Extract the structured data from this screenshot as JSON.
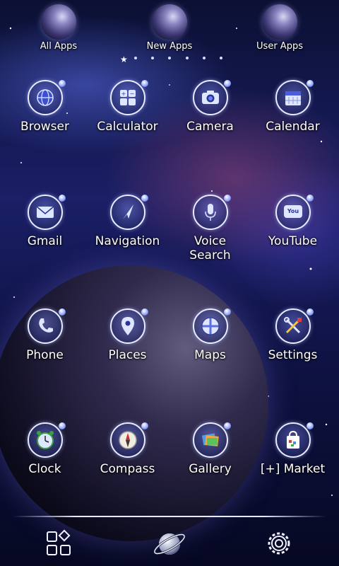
{
  "top_bar": {
    "items": [
      {
        "label": "All Apps",
        "icon": "planet-icon"
      },
      {
        "label": "New Apps",
        "icon": "planet-icon"
      },
      {
        "label": "User Apps",
        "icon": "planet-icon"
      }
    ],
    "page_indicator": {
      "count": 7,
      "active_index": 0
    }
  },
  "apps": [
    {
      "label": "Browser",
      "icon": "globe-icon"
    },
    {
      "label": "Calculator",
      "icon": "calculator-icon"
    },
    {
      "label": "Camera",
      "icon": "camera-icon"
    },
    {
      "label": "Calendar",
      "icon": "calendar-icon"
    },
    {
      "label": "Gmail",
      "icon": "mail-icon"
    },
    {
      "label": "Navigation",
      "icon": "navigation-arrow-icon"
    },
    {
      "label": "Voice\nSearch",
      "icon": "microphone-icon"
    },
    {
      "label": "YouTube",
      "icon": "tv-icon"
    },
    {
      "label": "Phone",
      "icon": "phone-icon"
    },
    {
      "label": "Places",
      "icon": "map-pin-icon"
    },
    {
      "label": "Maps",
      "icon": "map-globe-icon"
    },
    {
      "label": "Settings",
      "icon": "tools-icon"
    },
    {
      "label": "Clock",
      "icon": "alarm-clock-icon"
    },
    {
      "label": "Compass",
      "icon": "compass-icon"
    },
    {
      "label": "Gallery",
      "icon": "photos-icon"
    },
    {
      "label": "[+] Market",
      "icon": "shopping-bag-icon"
    }
  ],
  "youtube_badge": "You",
  "dock": {
    "left_icon": "app-drawer-grid-icon",
    "center_icon": "saturn-home-icon",
    "right_icon": "settings-gear-icon"
  },
  "colors": {
    "ring": "#e8ecff",
    "accent": "#8aa0ff",
    "background_dark": "#0b1033"
  }
}
